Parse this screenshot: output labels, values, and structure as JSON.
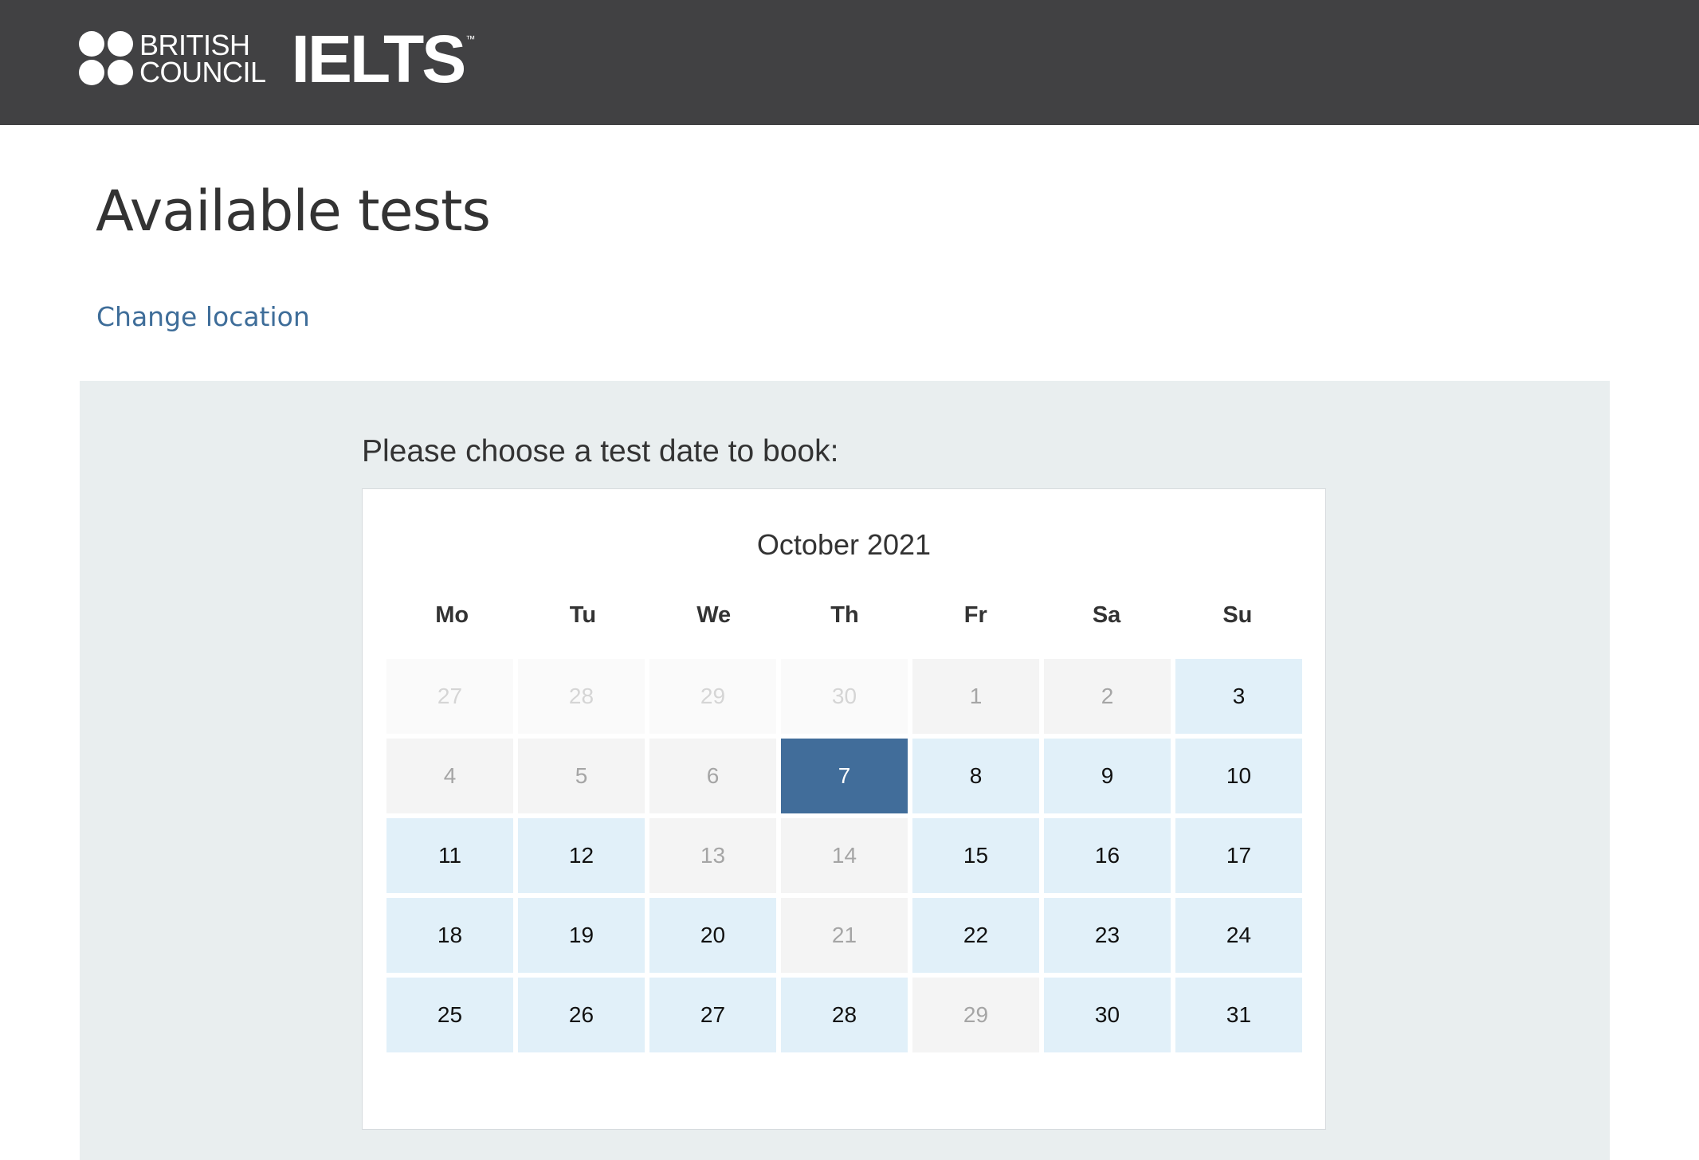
{
  "header": {
    "brand_line1": "BRITISH",
    "brand_line2": "COUNCIL",
    "product": "IELTS",
    "trademark": "™"
  },
  "page": {
    "title": "Available tests",
    "change_location_label": "Change location",
    "prompt": "Please choose a test date to book:"
  },
  "calendar": {
    "month_label": "October 2021",
    "weekdays": [
      "Mo",
      "Tu",
      "We",
      "Th",
      "Fr",
      "Sa",
      "Su"
    ],
    "selected_day": "7",
    "days": [
      {
        "label": "27",
        "state": "other"
      },
      {
        "label": "28",
        "state": "other"
      },
      {
        "label": "29",
        "state": "other"
      },
      {
        "label": "30",
        "state": "other"
      },
      {
        "label": "1",
        "state": "unavailable"
      },
      {
        "label": "2",
        "state": "unavailable"
      },
      {
        "label": "3",
        "state": "available"
      },
      {
        "label": "4",
        "state": "unavailable"
      },
      {
        "label": "5",
        "state": "unavailable"
      },
      {
        "label": "6",
        "state": "unavailable"
      },
      {
        "label": "7",
        "state": "selected"
      },
      {
        "label": "8",
        "state": "available"
      },
      {
        "label": "9",
        "state": "available"
      },
      {
        "label": "10",
        "state": "available"
      },
      {
        "label": "11",
        "state": "available"
      },
      {
        "label": "12",
        "state": "available"
      },
      {
        "label": "13",
        "state": "unavailable"
      },
      {
        "label": "14",
        "state": "unavailable"
      },
      {
        "label": "15",
        "state": "available"
      },
      {
        "label": "16",
        "state": "available"
      },
      {
        "label": "17",
        "state": "available"
      },
      {
        "label": "18",
        "state": "available"
      },
      {
        "label": "19",
        "state": "available"
      },
      {
        "label": "20",
        "state": "available"
      },
      {
        "label": "21",
        "state": "unavailable"
      },
      {
        "label": "22",
        "state": "available"
      },
      {
        "label": "23",
        "state": "available"
      },
      {
        "label": "24",
        "state": "available"
      },
      {
        "label": "25",
        "state": "available"
      },
      {
        "label": "26",
        "state": "available"
      },
      {
        "label": "27",
        "state": "available"
      },
      {
        "label": "28",
        "state": "available"
      },
      {
        "label": "29",
        "state": "unavailable"
      },
      {
        "label": "30",
        "state": "available"
      },
      {
        "label": "31",
        "state": "available"
      }
    ]
  },
  "colors": {
    "header_bg": "#414143",
    "link": "#3e6d99",
    "panel_bg": "#e9eeef",
    "available_bg": "#e1f0f9",
    "unavailable_bg": "#f4f4f4",
    "selected_bg": "#416d9a"
  }
}
